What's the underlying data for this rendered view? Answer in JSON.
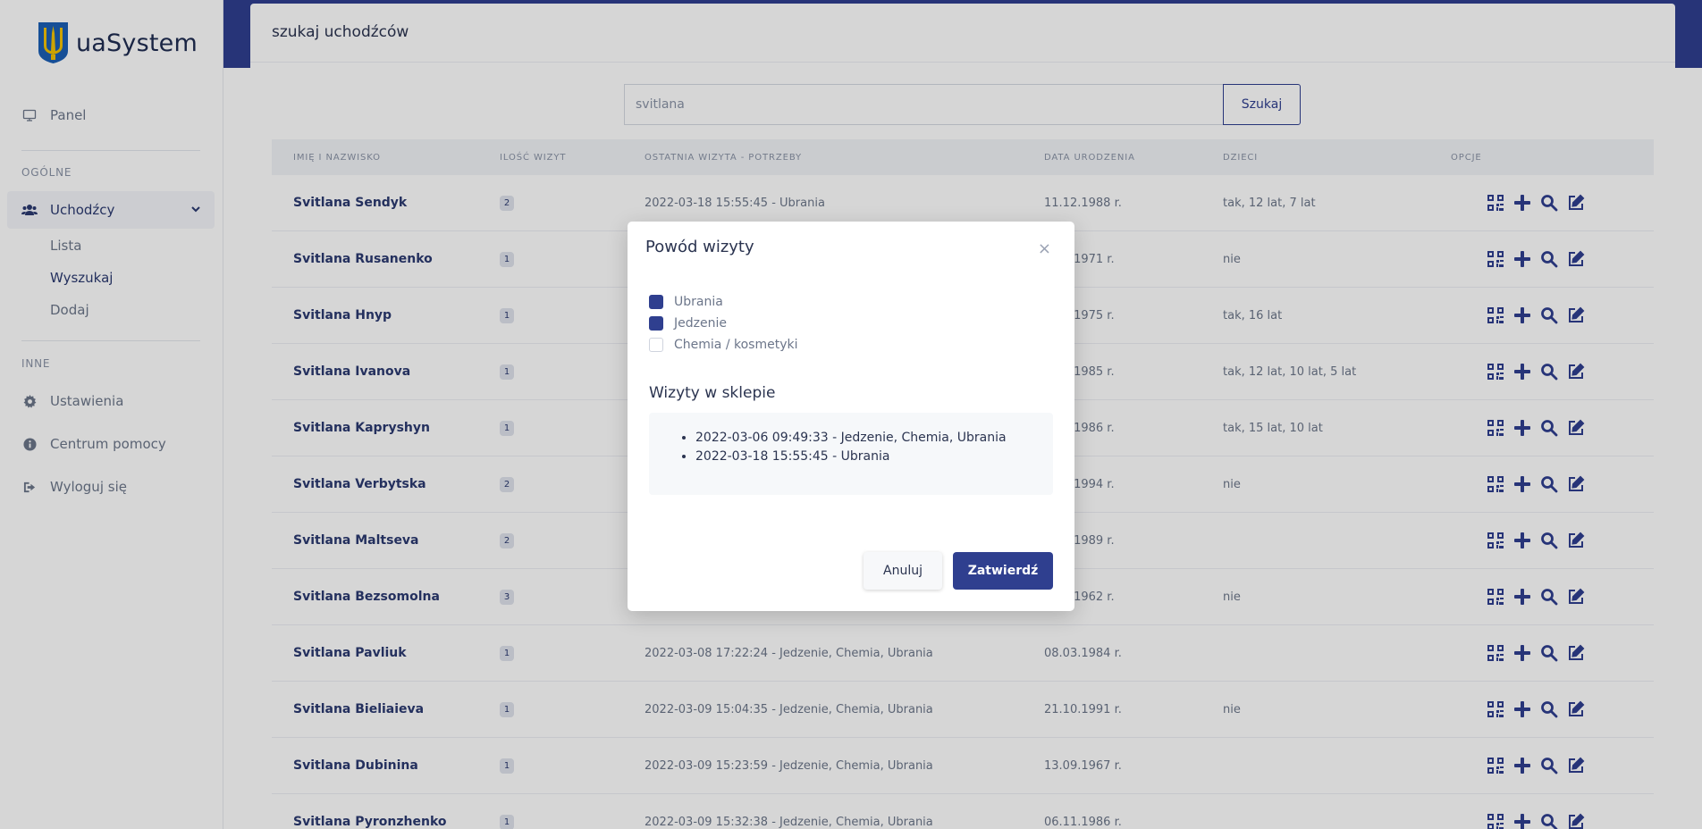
{
  "brand": {
    "name": "uaSystem"
  },
  "sidebar": {
    "panel_label": "Panel",
    "section_general": "OGÓLNE",
    "refugees_label": "Uchodźcy",
    "sub_items": [
      "Lista",
      "Wyszukaj",
      "Dodaj"
    ],
    "section_other": "INNE",
    "settings_label": "Ustawienia",
    "help_label": "Centrum pomocy",
    "logout_label": "Wyloguj się"
  },
  "page": {
    "title": "szukaj uchodźców",
    "search": {
      "value": "svitlana",
      "button_label": "Szukaj"
    }
  },
  "table": {
    "headers": [
      "IMIĘ I NAZWISKO",
      "ILOŚĆ WIZYT",
      "OSTATNIA WIZYTA - POTRZEBY",
      "DATA URODZENIA",
      "DZIECI",
      "OPCJE"
    ],
    "rows": [
      {
        "name": "Svitlana Sendyk",
        "visits": "2",
        "last_visit": "2022-03-18 15:55:45 - Ubrania",
        "birth": "11.12.1988 r.",
        "children": "tak, 12 lat, 7 lat"
      },
      {
        "name": "Svitlana Rusanenko",
        "visits": "1",
        "last_visit": "",
        "birth": "7.12.1971 r.",
        "children": "nie"
      },
      {
        "name": "Svitlana Hnyp",
        "visits": "1",
        "last_visit": "",
        "birth": "2.10.1975 r.",
        "children": "tak, 16 lat"
      },
      {
        "name": "Svitlana Ivanova",
        "visits": "1",
        "last_visit": "",
        "birth": "3.03.1985 r.",
        "children": "tak, 12 lat, 10 lat, 5 lat"
      },
      {
        "name": "Svitlana Kapryshyn",
        "visits": "1",
        "last_visit": "",
        "birth": "7.11.1986 r.",
        "children": "tak, 15 lat, 10 lat"
      },
      {
        "name": "Svitlana Verbytska",
        "visits": "2",
        "last_visit": "",
        "birth": "3.03.1994 r.",
        "children": "nie"
      },
      {
        "name": "Svitlana Maltseva",
        "visits": "2",
        "last_visit": "",
        "birth": "7.03.1989 r.",
        "children": ""
      },
      {
        "name": "Svitlana Bezsomolna",
        "visits": "3",
        "last_visit": "",
        "birth": "2.11.1962 r.",
        "children": "nie"
      },
      {
        "name": "Svitlana Pavliuk",
        "visits": "1",
        "last_visit": "2022-03-08 17:22:24 - Jedzenie, Chemia, Ubrania",
        "birth": "08.03.1984 r.",
        "children": ""
      },
      {
        "name": "Svitlana Bieliaieva",
        "visits": "1",
        "last_visit": "2022-03-09 15:04:35 - Jedzenie, Chemia, Ubrania",
        "birth": "21.10.1991 r.",
        "children": "nie"
      },
      {
        "name": "Svitlana Dubinina",
        "visits": "1",
        "last_visit": "2022-03-09 15:23:59 - Jedzenie, Chemia, Ubrania",
        "birth": "13.09.1967 r.",
        "children": ""
      },
      {
        "name": "Svitlana Pyronzhenko",
        "visits": "1",
        "last_visit": "2022-03-09 15:32:38 - Jedzenie, Chemia, Ubrania",
        "birth": "06.11.1986 r.",
        "children": ""
      }
    ]
  },
  "modal": {
    "title": "Powód wizyty",
    "close": "×",
    "checks": [
      {
        "label": "Ubrania",
        "checked": true
      },
      {
        "label": "Jedzenie",
        "checked": true
      },
      {
        "label": "Chemia / kosmetyki",
        "checked": false
      }
    ],
    "visits_title": "Wizyty w sklepie",
    "visits": [
      "2022-03-06 09:49:33 - Jedzenie, Chemia, Ubrania",
      "2022-03-18 15:55:45 - Ubrania"
    ],
    "cancel_label": "Anuluj",
    "confirm_label": "Zatwierdź"
  },
  "icons": [
    "monitor-icon",
    "users-icon",
    "chevron-down-icon",
    "gear-icon",
    "info-icon",
    "logout-icon",
    "qr-code-icon",
    "plus-icon",
    "search-icon",
    "edit-icon",
    "trident-logo"
  ],
  "colors": {
    "primary": "#2f3f8f",
    "text_dark": "#2b3450",
    "muted": "#6c768a",
    "logo_blue": "#1b5fb4",
    "logo_gold": "#f3c300"
  }
}
